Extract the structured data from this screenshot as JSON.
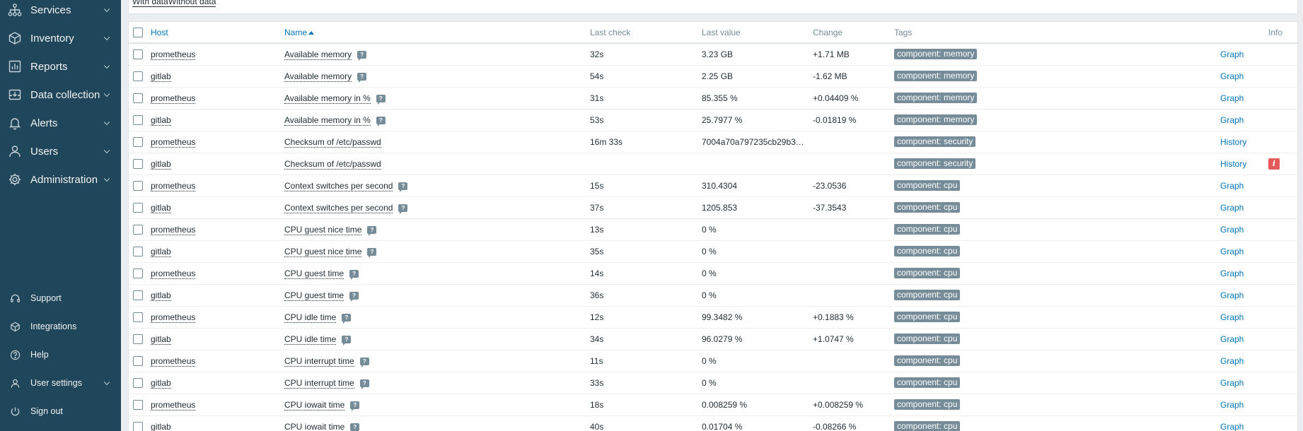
{
  "sidebar": {
    "main_items": [
      {
        "label": "Services",
        "icon": "services-icon"
      },
      {
        "label": "Inventory",
        "icon": "inventory-icon"
      },
      {
        "label": "Reports",
        "icon": "reports-icon"
      },
      {
        "label": "Data collection",
        "icon": "data-collection-icon"
      },
      {
        "label": "Alerts",
        "icon": "alerts-icon"
      },
      {
        "label": "Users",
        "icon": "users-icon"
      },
      {
        "label": "Administration",
        "icon": "administration-icon"
      }
    ],
    "bottom_items": [
      {
        "label": "Support",
        "icon": "support-icon"
      },
      {
        "label": "Integrations",
        "icon": "integrations-icon"
      },
      {
        "label": "Help",
        "icon": "help-icon"
      },
      {
        "label": "User settings",
        "icon": "user-settings-icon"
      },
      {
        "label": "Sign out",
        "icon": "sign-out-icon"
      }
    ]
  },
  "filter": {
    "with_data": "With data",
    "without_data": "Without data"
  },
  "table": {
    "headers": {
      "host": "Host",
      "name": "Name",
      "last_check": "Last check",
      "last_value": "Last value",
      "change": "Change",
      "tags": "Tags",
      "info": "Info"
    },
    "rows": [
      {
        "host": "prometheus",
        "name": "Available memory",
        "desc": true,
        "last_check": "32s",
        "last_value": "3.23 GB",
        "change": "+1.71 MB",
        "tag": "component: memory",
        "action": "Graph",
        "info": false
      },
      {
        "host": "gitlab",
        "name": "Available memory",
        "desc": true,
        "last_check": "54s",
        "last_value": "2.25 GB",
        "change": "-1.62 MB",
        "tag": "component: memory",
        "action": "Graph",
        "info": false
      },
      {
        "host": "prometheus",
        "name": "Available memory in %",
        "desc": true,
        "last_check": "31s",
        "last_value": "85.355 %",
        "change": "+0.04409 %",
        "tag": "component: memory",
        "action": "Graph",
        "info": false
      },
      {
        "host": "gitlab",
        "name": "Available memory in %",
        "desc": true,
        "last_check": "53s",
        "last_value": "25.7977 %",
        "change": "-0.01819 %",
        "tag": "component: memory",
        "action": "Graph",
        "info": false
      },
      {
        "host": "prometheus",
        "name": "Checksum of /etc/passwd",
        "desc": false,
        "last_check": "16m 33s",
        "last_value": "7004a70a797235cb29b3…",
        "change": "",
        "tag": "component: security",
        "action": "History",
        "info": false
      },
      {
        "host": "gitlab",
        "name": "Checksum of /etc/passwd",
        "desc": false,
        "last_check": "",
        "last_value": "",
        "change": "",
        "tag": "component: security",
        "action": "History",
        "info": true
      },
      {
        "host": "prometheus",
        "name": "Context switches per second",
        "desc": true,
        "last_check": "15s",
        "last_value": "310.4304",
        "change": "-23.0536",
        "tag": "component: cpu",
        "action": "Graph",
        "info": false
      },
      {
        "host": "gitlab",
        "name": "Context switches per second",
        "desc": true,
        "last_check": "37s",
        "last_value": "1205.853",
        "change": "-37.3543",
        "tag": "component: cpu",
        "action": "Graph",
        "info": false
      },
      {
        "host": "prometheus",
        "name": "CPU guest nice time",
        "desc": true,
        "last_check": "13s",
        "last_value": "0 %",
        "change": "",
        "tag": "component: cpu",
        "action": "Graph",
        "info": false
      },
      {
        "host": "gitlab",
        "name": "CPU guest nice time",
        "desc": true,
        "last_check": "35s",
        "last_value": "0 %",
        "change": "",
        "tag": "component: cpu",
        "action": "Graph",
        "info": false
      },
      {
        "host": "prometheus",
        "name": "CPU guest time",
        "desc": true,
        "last_check": "14s",
        "last_value": "0 %",
        "change": "",
        "tag": "component: cpu",
        "action": "Graph",
        "info": false
      },
      {
        "host": "gitlab",
        "name": "CPU guest time",
        "desc": true,
        "last_check": "36s",
        "last_value": "0 %",
        "change": "",
        "tag": "component: cpu",
        "action": "Graph",
        "info": false
      },
      {
        "host": "prometheus",
        "name": "CPU idle time",
        "desc": true,
        "last_check": "12s",
        "last_value": "99.3482 %",
        "change": "+0.1883 %",
        "tag": "component: cpu",
        "action": "Graph",
        "info": false
      },
      {
        "host": "gitlab",
        "name": "CPU idle time",
        "desc": true,
        "last_check": "34s",
        "last_value": "96.0279 %",
        "change": "+1.0747 %",
        "tag": "component: cpu",
        "action": "Graph",
        "info": false
      },
      {
        "host": "prometheus",
        "name": "CPU interrupt time",
        "desc": true,
        "last_check": "11s",
        "last_value": "0 %",
        "change": "",
        "tag": "component: cpu",
        "action": "Graph",
        "info": false
      },
      {
        "host": "gitlab",
        "name": "CPU interrupt time",
        "desc": true,
        "last_check": "33s",
        "last_value": "0 %",
        "change": "",
        "tag": "component: cpu",
        "action": "Graph",
        "info": false
      },
      {
        "host": "prometheus",
        "name": "CPU iowait time",
        "desc": true,
        "last_check": "18s",
        "last_value": "0.008259 %",
        "change": "+0.008259 %",
        "tag": "component: cpu",
        "action": "Graph",
        "info": false
      },
      {
        "host": "gitlab",
        "name": "CPU iowait time",
        "desc": true,
        "last_check": "40s",
        "last_value": "0.01704 %",
        "change": "-0.08266 %",
        "tag": "component: cpu",
        "action": "Graph",
        "info": false
      }
    ]
  }
}
